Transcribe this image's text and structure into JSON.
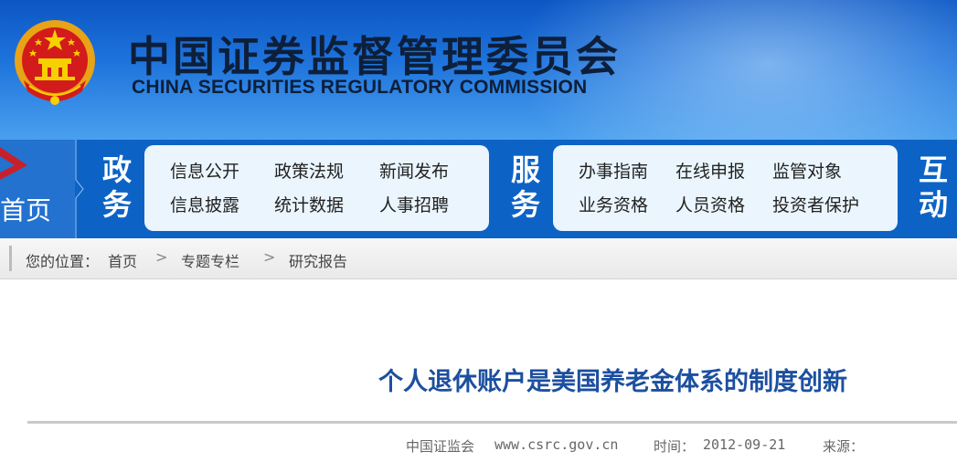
{
  "header": {
    "title_cn": "中国证券监督管理委员会",
    "title_en": "CHINA SECURITIES REGULATORY COMMISSION"
  },
  "nav": {
    "home_label": "首页",
    "gov_label": "政务",
    "gov_items": [
      "信息公开",
      "政策法规",
      "新闻发布",
      "信息披露",
      "统计数据",
      "人事招聘"
    ],
    "service_label": "服务",
    "service_items": [
      "办事指南",
      "在线申报",
      "监管对象",
      "业务资格",
      "人员资格",
      "投资者保护"
    ],
    "interact_label": "互动"
  },
  "breadcrumb": {
    "prefix": "您的位置：",
    "items": [
      "首页",
      "专题专栏",
      "研究报告"
    ],
    "separator": ">"
  },
  "article": {
    "title": "个人退休账户是美国养老金体系的制度创新",
    "source_site": "中国证监会",
    "url": "www.csrc.gov.cn",
    "time_label": "时间：",
    "time_value": "2012-09-21",
    "source_label": "来源："
  },
  "colors": {
    "banner_blue": "#1f74dc",
    "nav_blue": "#0d63c5",
    "title_blue": "#1c4f9f"
  }
}
